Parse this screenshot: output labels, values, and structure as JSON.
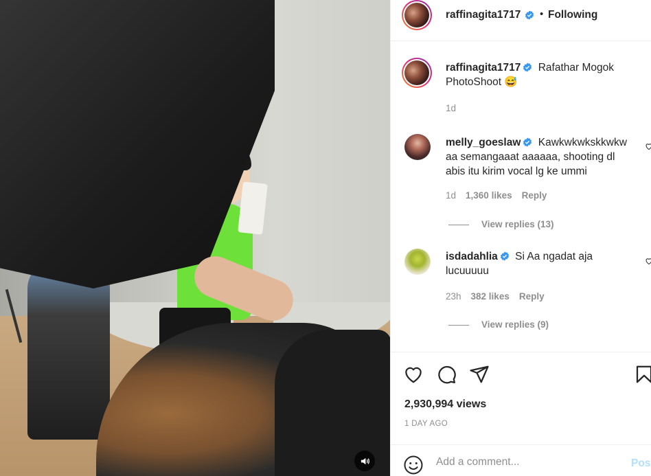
{
  "post": {
    "username": "raffinagita1717",
    "follow_separator": "•",
    "follow_status": "Following"
  },
  "caption": {
    "username": "raffinagita1717",
    "text_line1": "Rafathar Mogok",
    "text_line2": "PhotoShoot",
    "emoji": "😅",
    "time": "1d"
  },
  "comments": [
    {
      "username": "melly_goeslaw",
      "line1": "Kawkwkwkskkwkw",
      "line2": "aa semangaaat aaaaaa, shooting dl",
      "line3": "abis itu kirim vocal lg ke ummi",
      "time": "1d",
      "likes": "1,360 likes",
      "reply": "Reply",
      "view_replies": "View replies (13)"
    },
    {
      "username": "isdadahlia",
      "line1": "Si Aa ngadat aja",
      "line2": "lucuuuuu",
      "time": "23h",
      "likes": "382 likes",
      "reply": "Reply",
      "view_replies": "View replies (9)"
    }
  ],
  "stats": {
    "views": "2,930,994 views",
    "posted": "1 DAY AGO"
  },
  "composer": {
    "placeholder": "Add a comment...",
    "post_label": "Post"
  },
  "colors": {
    "verified": "#3897f0",
    "muted": "#8e8e8e",
    "post_disabled": "#b2dffc"
  },
  "icons": {
    "like": "heart-icon",
    "comment": "comment-bubble-icon",
    "share": "paper-plane-icon",
    "save": "bookmark-icon",
    "audio": "speaker-icon",
    "emoji": "smiley-icon"
  }
}
